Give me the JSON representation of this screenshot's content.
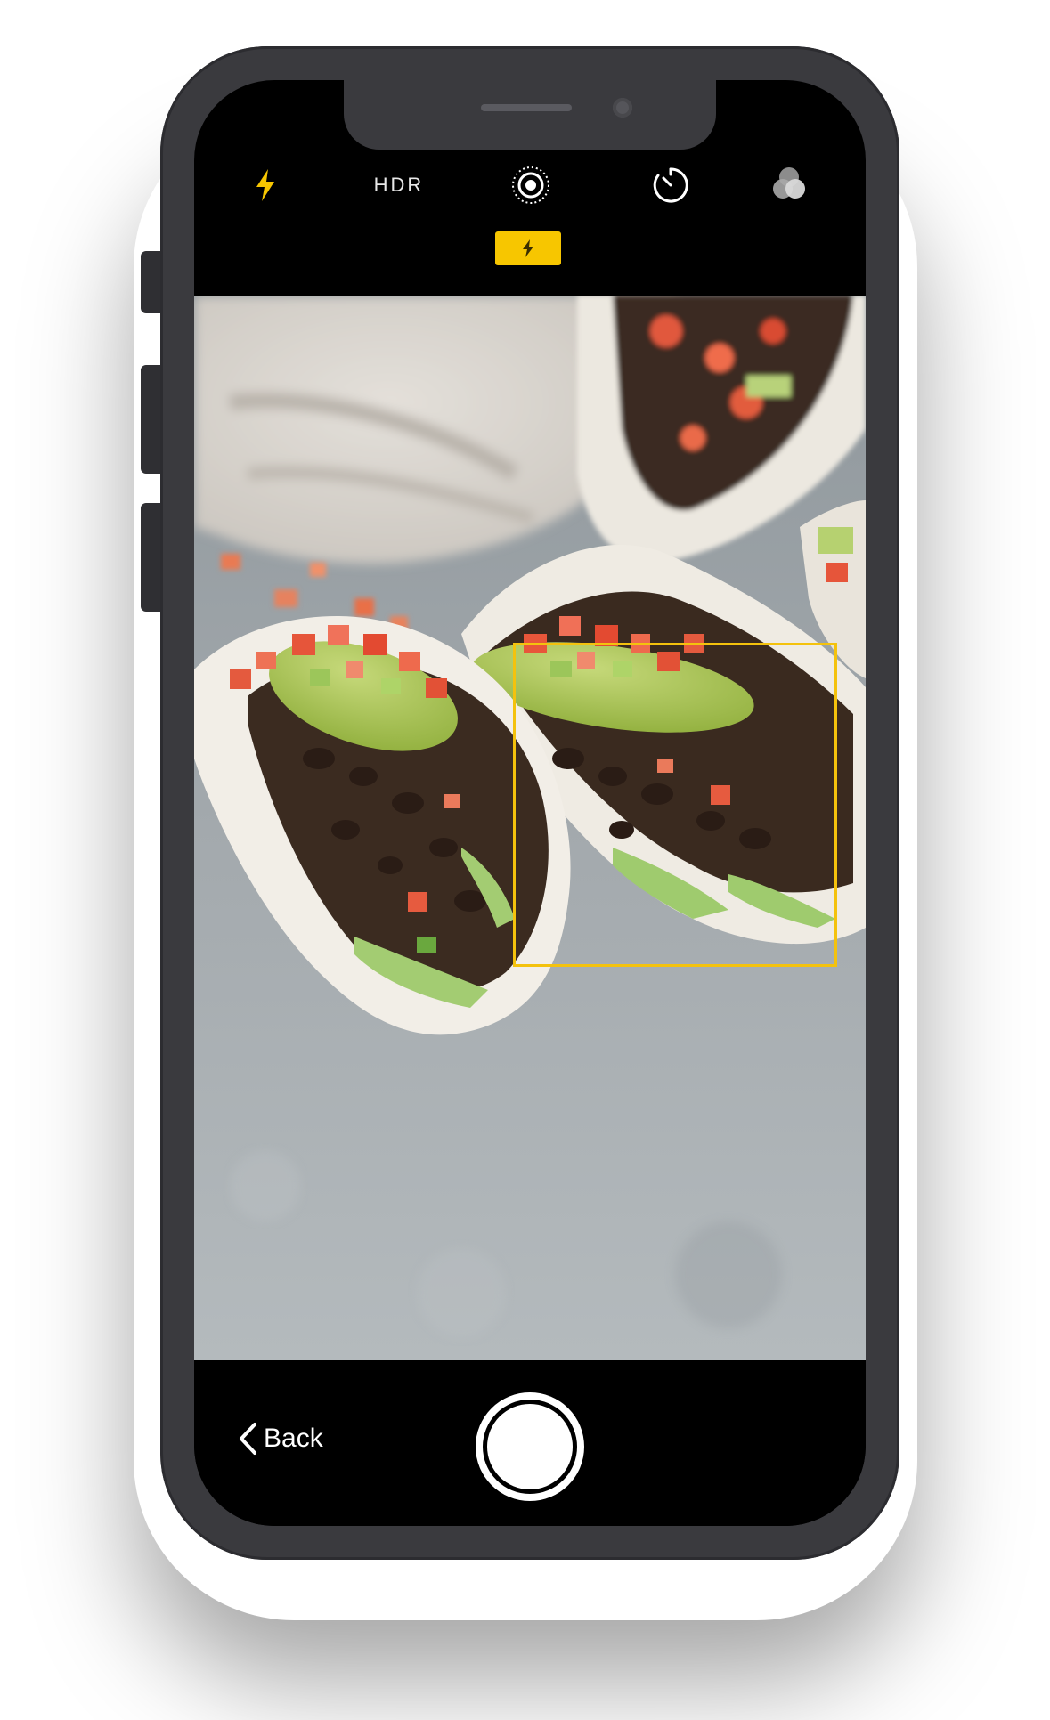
{
  "camera": {
    "top_bar": {
      "flash_icon": "flash-icon",
      "hdr_label": "HDR",
      "live_photo_icon": "live-photo-icon",
      "timer_icon": "timer-icon",
      "filters_icon": "filters-icon"
    },
    "flash_badge_icon": "flash-icon",
    "viewfinder": {
      "subject": "photo-preview"
    },
    "bottom_bar": {
      "back_label": "Back",
      "back_icon": "chevron-left-icon",
      "shutter": "shutter-button"
    }
  },
  "colors": {
    "accent": "#f7c600",
    "focus_box": "#f4c20d",
    "phone_frame": "#3a3a3e",
    "screen_bg": "#000000"
  }
}
